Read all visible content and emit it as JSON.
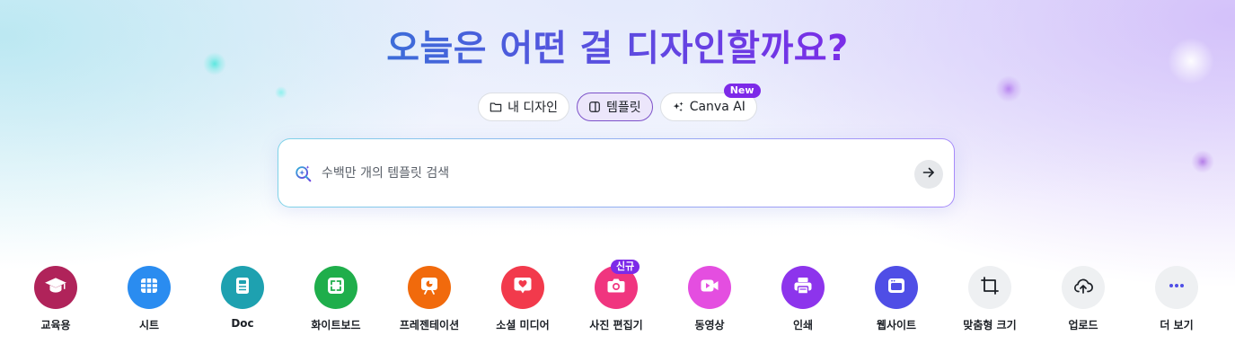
{
  "colors": {
    "accent": "#7d2ae8",
    "title_gradient_start": "#3a6fd8",
    "title_gradient_end": "#7d2ae8"
  },
  "hero": {
    "title": "오늘은 어떤 걸 디자인할까요?"
  },
  "tabs": [
    {
      "label": "내 디자인",
      "icon": "folder-icon",
      "active": false
    },
    {
      "label": "템플릿",
      "icon": "template-icon",
      "active": true
    },
    {
      "label": "Canva AI",
      "icon": "sparkle-icon",
      "active": false,
      "badge": "New"
    }
  ],
  "search": {
    "placeholder": "수백만 개의 템플릿 검색",
    "value": "",
    "icon": "magic-search-icon",
    "submit_icon": "arrow-right-icon"
  },
  "shortcuts": [
    {
      "label": "교육용",
      "icon": "graduation-cap-icon",
      "color": "#b0235a"
    },
    {
      "label": "시트",
      "icon": "sheet-grid-icon",
      "color": "#2a8cf0"
    },
    {
      "label": "Doc",
      "icon": "document-icon",
      "color": "#1ea1b0"
    },
    {
      "label": "화이트보드",
      "icon": "whiteboard-icon",
      "color": "#1fae4b"
    },
    {
      "label": "프레젠테이션",
      "icon": "presentation-icon",
      "color": "#f16a0c"
    },
    {
      "label": "소셜 미디어",
      "icon": "heart-icon",
      "color": "#f23a4c"
    },
    {
      "label": "사진 편집기",
      "icon": "camera-icon",
      "color": "#f0357f",
      "badge": "신규"
    },
    {
      "label": "동영상",
      "icon": "video-icon",
      "color": "#e44ee0"
    },
    {
      "label": "인쇄",
      "icon": "printer-icon",
      "color": "#8d34ec"
    },
    {
      "label": "웹사이트",
      "icon": "website-icon",
      "color": "#4f4ee6"
    },
    {
      "label": "맞춤형 크기",
      "icon": "custom-size-icon",
      "color": "#eef0f2"
    },
    {
      "label": "업로드",
      "icon": "cloud-upload-icon",
      "color": "#eef0f2"
    },
    {
      "label": "더 보기",
      "icon": "more-dots-icon",
      "color": "#eef0f2"
    }
  ]
}
